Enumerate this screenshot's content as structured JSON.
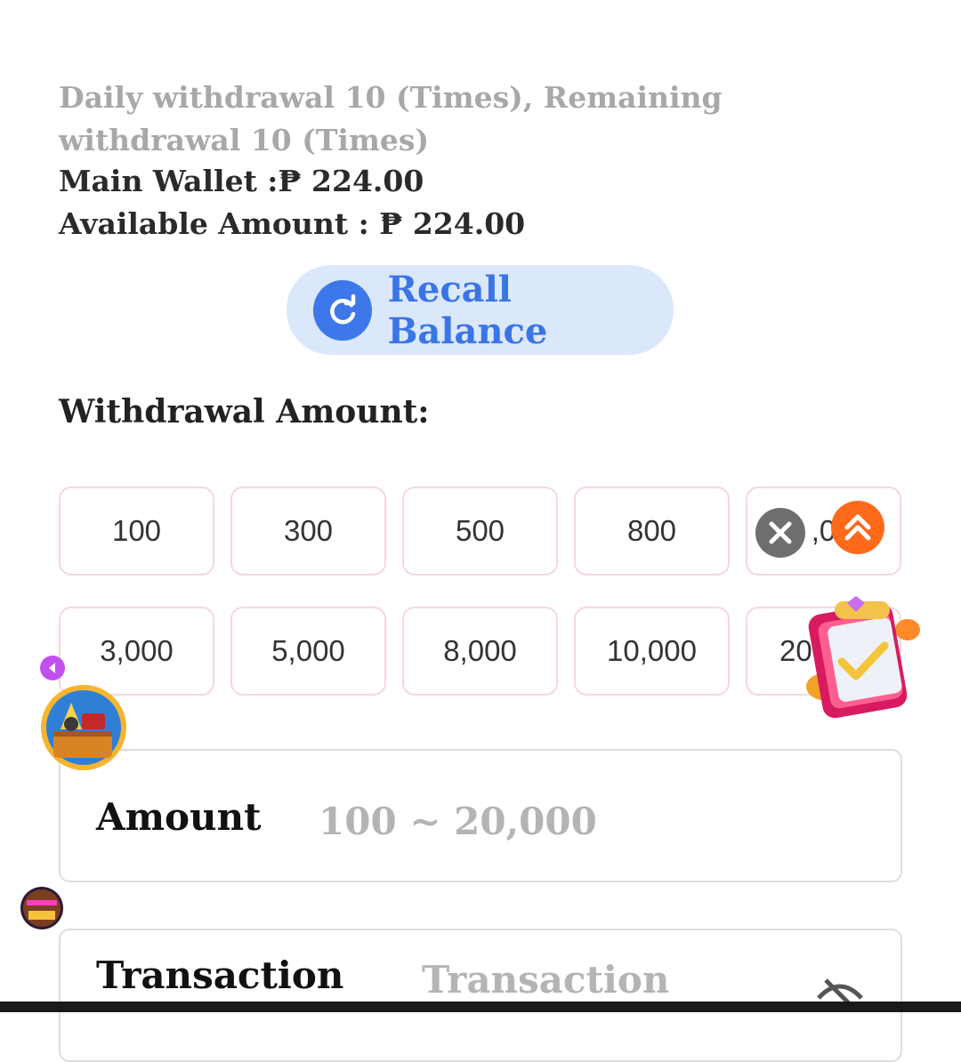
{
  "withdraw_limit_text": "Daily withdrawal 10 (Times), Remaining withdrawal 10 (Times)",
  "wallet": {
    "main_label": "Main Wallet :",
    "main_value": "₱ 224.00",
    "available_label": "Available Amount : ",
    "available_value": "₱ 224.00"
  },
  "recall_button": {
    "label": "Recall Balance"
  },
  "withdrawal_amount": {
    "title": "Withdrawal Amount:",
    "row1": [
      "100",
      "300",
      "500",
      "800",
      ",0"
    ],
    "row2": [
      "3,000",
      "5,000",
      "8,000",
      "10,000",
      "20"
    ]
  },
  "amount_field": {
    "label": "Amount",
    "placeholder": "100 ~ 20,000"
  },
  "transaction_field": {
    "label": "Transaction",
    "placeholder": "Transaction"
  },
  "floating": {
    "left_game_icon": "treasure-chest-icon",
    "jilipark_icon": "jilipark-logo",
    "close_icon": "close-icon",
    "scroll_top_icon": "double-chevron-up-icon",
    "mission_icon": "mission-book-icon"
  },
  "colors": {
    "accent": "#3d78ea",
    "recall_bg": "#dbe8fb",
    "chip_border": "#f5d8dc",
    "scroll_top": "#ff6a1a"
  }
}
